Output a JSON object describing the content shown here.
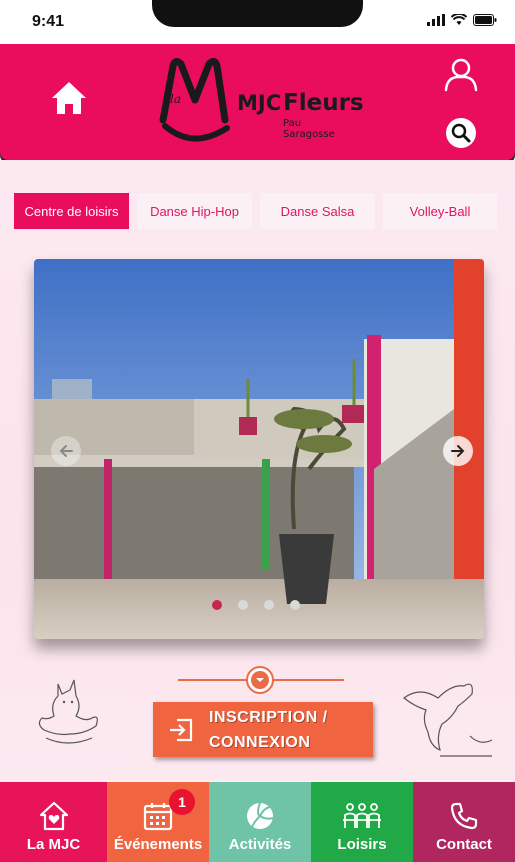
{
  "status_bar": {
    "time": "9:41"
  },
  "header": {
    "logo": {
      "text_main": "MJC",
      "text_brand": "Fleurs",
      "text_la": "la",
      "text_sub1": "Pau",
      "text_sub2": "Saragosse"
    },
    "colors": {
      "primary": "#ea0d5e"
    }
  },
  "tabs": [
    {
      "label": "Centre de loisirs",
      "active": true
    },
    {
      "label": "Danse Hip-Hop",
      "active": false
    },
    {
      "label": "Danse Salsa",
      "active": false
    },
    {
      "label": "Volley-Ball",
      "active": false
    }
  ],
  "carousel": {
    "slide_count": 4,
    "active_index": 0
  },
  "login_button": {
    "line1": "INSCRIPTION /",
    "line2": "CONNEXION"
  },
  "bottom_nav": [
    {
      "label": "La MJC",
      "icon": "house-heart-icon",
      "color": "#e8145a"
    },
    {
      "label": "Événements",
      "icon": "calendar-icon",
      "color": "#f06440",
      "badge": "1"
    },
    {
      "label": "Activités",
      "icon": "volleyball-icon",
      "color": "#6fc3a6"
    },
    {
      "label": "Loisirs",
      "icon": "group-icon",
      "color": "#21a847"
    },
    {
      "label": "Contact",
      "icon": "phone-icon",
      "color": "#b0265f"
    }
  ]
}
